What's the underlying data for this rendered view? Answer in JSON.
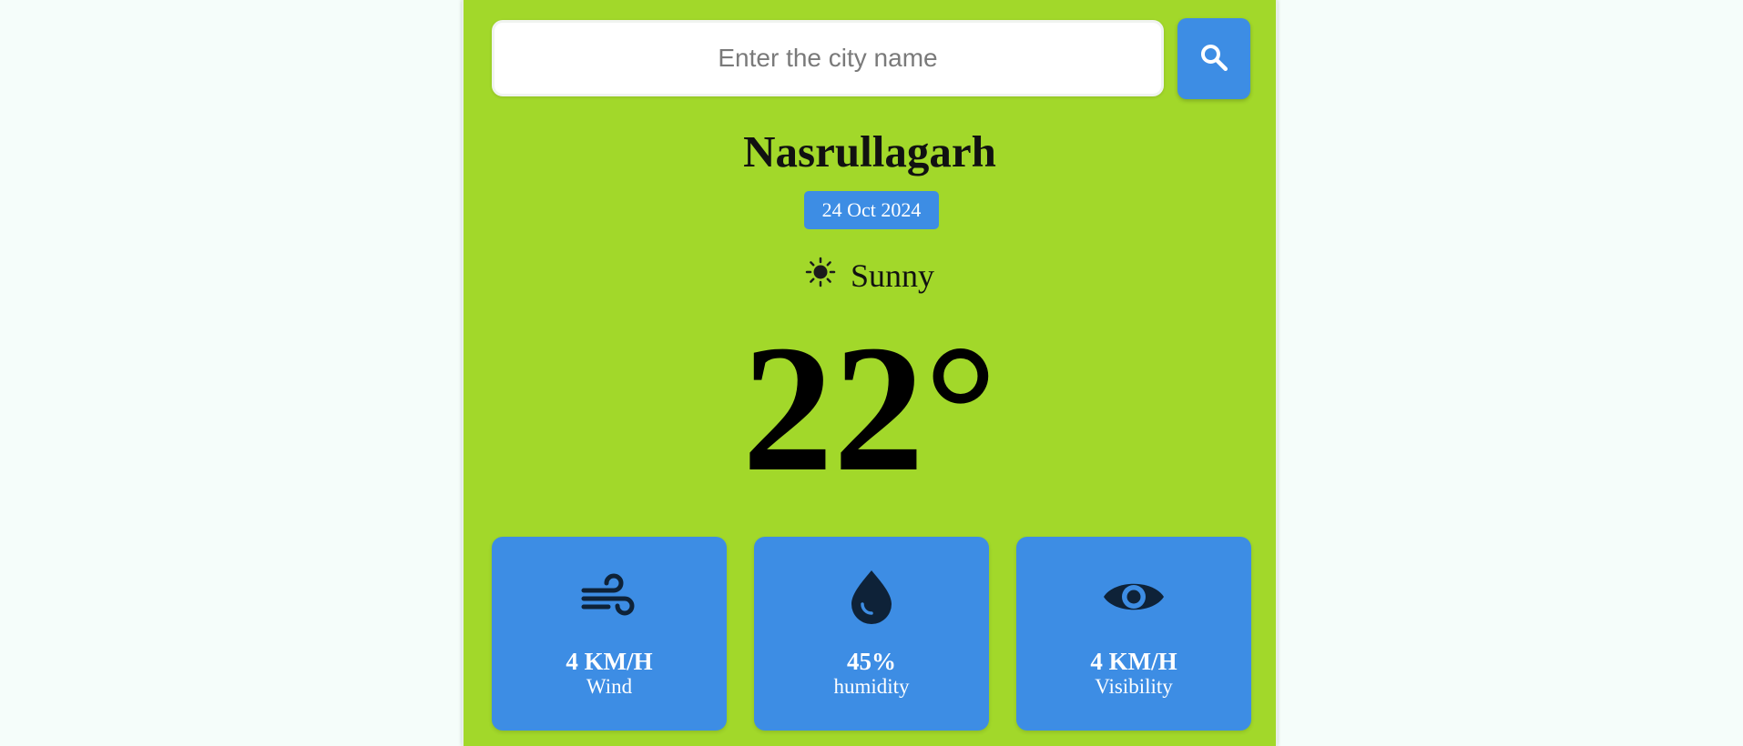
{
  "search": {
    "placeholder": "Enter the city name",
    "value": ""
  },
  "location": {
    "city": "Nasrullagarh",
    "date": "24 Oct 2024"
  },
  "weather": {
    "condition": "Sunny",
    "condition_icon": "sun-icon",
    "temperature": "22°"
  },
  "stats": [
    {
      "icon": "wind-icon",
      "value": "4 KM/H",
      "label": "Wind"
    },
    {
      "icon": "droplet-icon",
      "value": "45%",
      "label": "humidity"
    },
    {
      "icon": "eye-icon",
      "value": "4 KM/H",
      "label": "Visibility"
    }
  ],
  "colors": {
    "card_bg": "#a2d82a",
    "accent": "#3d8de4",
    "icon_dark": "#0e2238",
    "page_bg": "#f5fdfa"
  }
}
